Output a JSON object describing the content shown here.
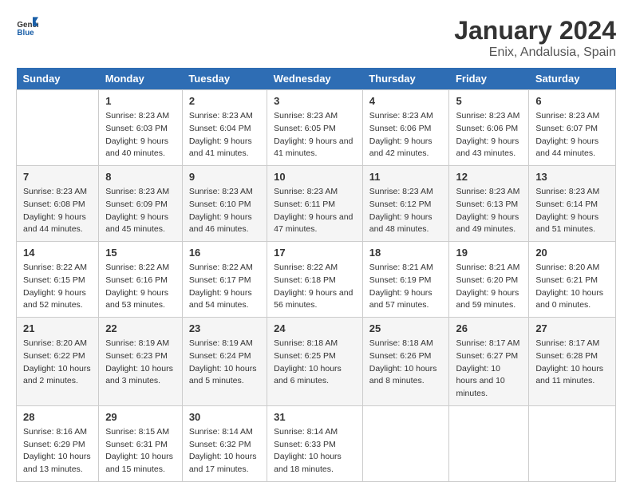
{
  "logo": {
    "text_general": "General",
    "text_blue": "Blue"
  },
  "title": "January 2024",
  "subtitle": "Enix, Andalusia, Spain",
  "header_days": [
    "Sunday",
    "Monday",
    "Tuesday",
    "Wednesday",
    "Thursday",
    "Friday",
    "Saturday"
  ],
  "weeks": [
    [
      {
        "day": "",
        "sunrise": "",
        "sunset": "",
        "daylight": ""
      },
      {
        "day": "1",
        "sunrise": "Sunrise: 8:23 AM",
        "sunset": "Sunset: 6:03 PM",
        "daylight": "Daylight: 9 hours and 40 minutes."
      },
      {
        "day": "2",
        "sunrise": "Sunrise: 8:23 AM",
        "sunset": "Sunset: 6:04 PM",
        "daylight": "Daylight: 9 hours and 41 minutes."
      },
      {
        "day": "3",
        "sunrise": "Sunrise: 8:23 AM",
        "sunset": "Sunset: 6:05 PM",
        "daylight": "Daylight: 9 hours and 41 minutes."
      },
      {
        "day": "4",
        "sunrise": "Sunrise: 8:23 AM",
        "sunset": "Sunset: 6:06 PM",
        "daylight": "Daylight: 9 hours and 42 minutes."
      },
      {
        "day": "5",
        "sunrise": "Sunrise: 8:23 AM",
        "sunset": "Sunset: 6:06 PM",
        "daylight": "Daylight: 9 hours and 43 minutes."
      },
      {
        "day": "6",
        "sunrise": "Sunrise: 8:23 AM",
        "sunset": "Sunset: 6:07 PM",
        "daylight": "Daylight: 9 hours and 44 minutes."
      }
    ],
    [
      {
        "day": "7",
        "sunrise": "Sunrise: 8:23 AM",
        "sunset": "Sunset: 6:08 PM",
        "daylight": "Daylight: 9 hours and 44 minutes."
      },
      {
        "day": "8",
        "sunrise": "Sunrise: 8:23 AM",
        "sunset": "Sunset: 6:09 PM",
        "daylight": "Daylight: 9 hours and 45 minutes."
      },
      {
        "day": "9",
        "sunrise": "Sunrise: 8:23 AM",
        "sunset": "Sunset: 6:10 PM",
        "daylight": "Daylight: 9 hours and 46 minutes."
      },
      {
        "day": "10",
        "sunrise": "Sunrise: 8:23 AM",
        "sunset": "Sunset: 6:11 PM",
        "daylight": "Daylight: 9 hours and 47 minutes."
      },
      {
        "day": "11",
        "sunrise": "Sunrise: 8:23 AM",
        "sunset": "Sunset: 6:12 PM",
        "daylight": "Daylight: 9 hours and 48 minutes."
      },
      {
        "day": "12",
        "sunrise": "Sunrise: 8:23 AM",
        "sunset": "Sunset: 6:13 PM",
        "daylight": "Daylight: 9 hours and 49 minutes."
      },
      {
        "day": "13",
        "sunrise": "Sunrise: 8:23 AM",
        "sunset": "Sunset: 6:14 PM",
        "daylight": "Daylight: 9 hours and 51 minutes."
      }
    ],
    [
      {
        "day": "14",
        "sunrise": "Sunrise: 8:22 AM",
        "sunset": "Sunset: 6:15 PM",
        "daylight": "Daylight: 9 hours and 52 minutes."
      },
      {
        "day": "15",
        "sunrise": "Sunrise: 8:22 AM",
        "sunset": "Sunset: 6:16 PM",
        "daylight": "Daylight: 9 hours and 53 minutes."
      },
      {
        "day": "16",
        "sunrise": "Sunrise: 8:22 AM",
        "sunset": "Sunset: 6:17 PM",
        "daylight": "Daylight: 9 hours and 54 minutes."
      },
      {
        "day": "17",
        "sunrise": "Sunrise: 8:22 AM",
        "sunset": "Sunset: 6:18 PM",
        "daylight": "Daylight: 9 hours and 56 minutes."
      },
      {
        "day": "18",
        "sunrise": "Sunrise: 8:21 AM",
        "sunset": "Sunset: 6:19 PM",
        "daylight": "Daylight: 9 hours and 57 minutes."
      },
      {
        "day": "19",
        "sunrise": "Sunrise: 8:21 AM",
        "sunset": "Sunset: 6:20 PM",
        "daylight": "Daylight: 9 hours and 59 minutes."
      },
      {
        "day": "20",
        "sunrise": "Sunrise: 8:20 AM",
        "sunset": "Sunset: 6:21 PM",
        "daylight": "Daylight: 10 hours and 0 minutes."
      }
    ],
    [
      {
        "day": "21",
        "sunrise": "Sunrise: 8:20 AM",
        "sunset": "Sunset: 6:22 PM",
        "daylight": "Daylight: 10 hours and 2 minutes."
      },
      {
        "day": "22",
        "sunrise": "Sunrise: 8:19 AM",
        "sunset": "Sunset: 6:23 PM",
        "daylight": "Daylight: 10 hours and 3 minutes."
      },
      {
        "day": "23",
        "sunrise": "Sunrise: 8:19 AM",
        "sunset": "Sunset: 6:24 PM",
        "daylight": "Daylight: 10 hours and 5 minutes."
      },
      {
        "day": "24",
        "sunrise": "Sunrise: 8:18 AM",
        "sunset": "Sunset: 6:25 PM",
        "daylight": "Daylight: 10 hours and 6 minutes."
      },
      {
        "day": "25",
        "sunrise": "Sunrise: 8:18 AM",
        "sunset": "Sunset: 6:26 PM",
        "daylight": "Daylight: 10 hours and 8 minutes."
      },
      {
        "day": "26",
        "sunrise": "Sunrise: 8:17 AM",
        "sunset": "Sunset: 6:27 PM",
        "daylight": "Daylight: 10 hours and 10 minutes."
      },
      {
        "day": "27",
        "sunrise": "Sunrise: 8:17 AM",
        "sunset": "Sunset: 6:28 PM",
        "daylight": "Daylight: 10 hours and 11 minutes."
      }
    ],
    [
      {
        "day": "28",
        "sunrise": "Sunrise: 8:16 AM",
        "sunset": "Sunset: 6:29 PM",
        "daylight": "Daylight: 10 hours and 13 minutes."
      },
      {
        "day": "29",
        "sunrise": "Sunrise: 8:15 AM",
        "sunset": "Sunset: 6:31 PM",
        "daylight": "Daylight: 10 hours and 15 minutes."
      },
      {
        "day": "30",
        "sunrise": "Sunrise: 8:14 AM",
        "sunset": "Sunset: 6:32 PM",
        "daylight": "Daylight: 10 hours and 17 minutes."
      },
      {
        "day": "31",
        "sunrise": "Sunrise: 8:14 AM",
        "sunset": "Sunset: 6:33 PM",
        "daylight": "Daylight: 10 hours and 18 minutes."
      },
      {
        "day": "",
        "sunrise": "",
        "sunset": "",
        "daylight": ""
      },
      {
        "day": "",
        "sunrise": "",
        "sunset": "",
        "daylight": ""
      },
      {
        "day": "",
        "sunrise": "",
        "sunset": "",
        "daylight": ""
      }
    ]
  ]
}
